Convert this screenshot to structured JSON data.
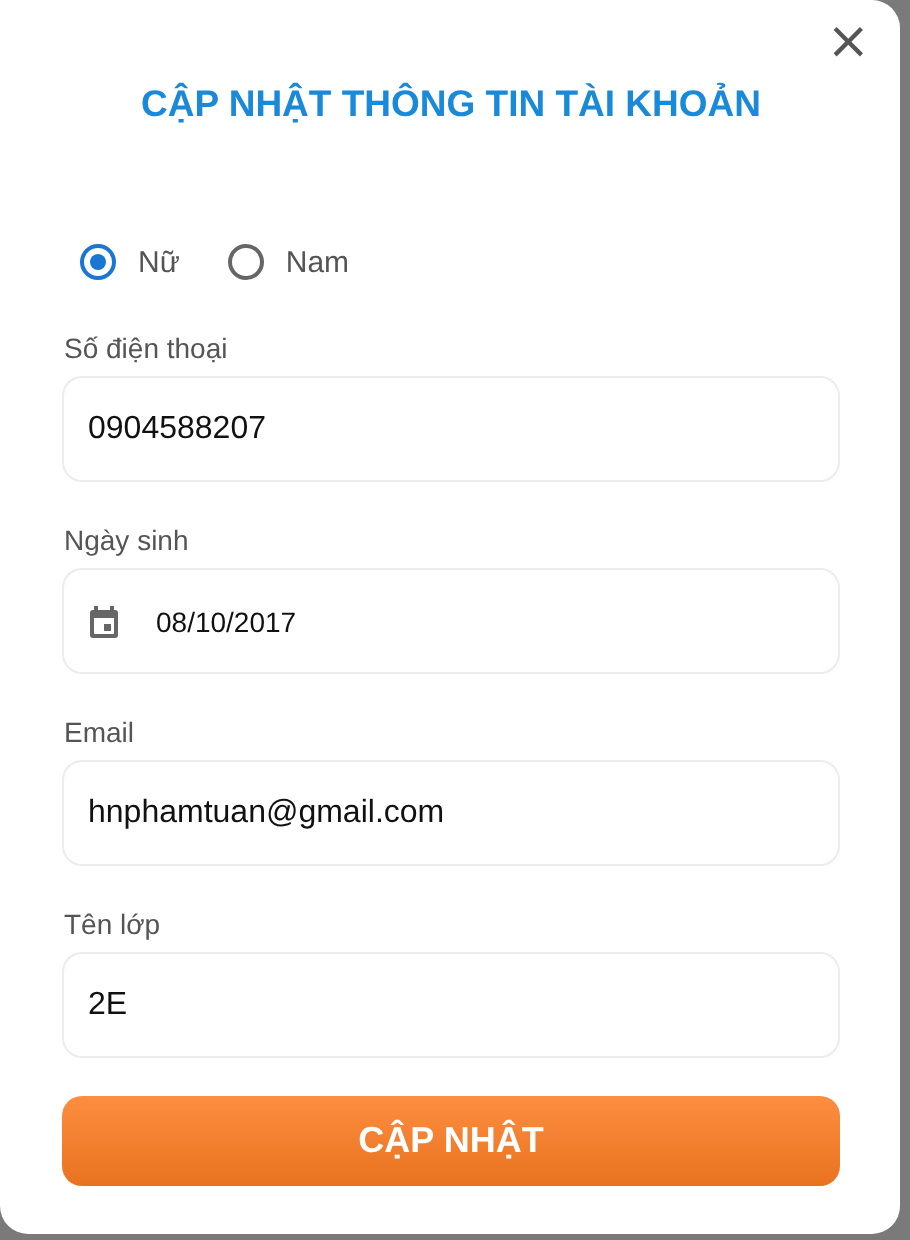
{
  "dialog": {
    "title": "CẬP NHẬT THÔNG TIN TÀI KHOẢN",
    "close": "×"
  },
  "gender": [
    {
      "label": "Nữ",
      "selected": true
    },
    {
      "label": "Nam",
      "selected": false
    }
  ],
  "fields": [
    {
      "kind": "text",
      "label": "Số điện thoại",
      "value": "0904588207"
    },
    {
      "kind": "date",
      "label": "Ngày sinh",
      "value": "08/10/2017"
    },
    {
      "kind": "text",
      "label": "Email",
      "value": "hnphamtuan@gmail.com"
    },
    {
      "kind": "text",
      "label": "Tên lớp",
      "value": "2E"
    }
  ],
  "submit": "CẬP NHẬT"
}
